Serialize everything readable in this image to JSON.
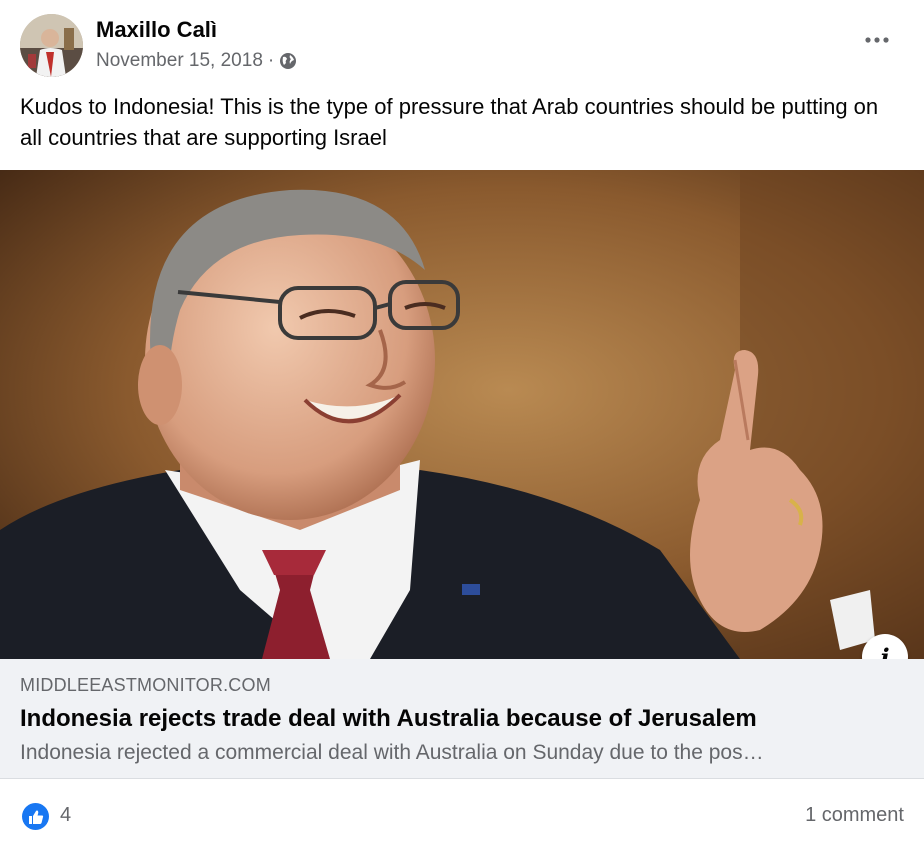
{
  "post": {
    "author": "Maxillo Calì",
    "date": "November 15, 2018",
    "separator": "·",
    "visibility_icon": "globe-icon",
    "menu_icon": "more-options-icon",
    "text": "Kudos to Indonesia! This is the type of pressure that Arab countries should be putting on all countries that are supporting Israel"
  },
  "link_preview": {
    "image_icon": "photo-of-smiling-man-pointing-finger",
    "info_icon": "info-icon",
    "domain": "MIDDLEEASTMONITOR.COM",
    "title": "Indonesia rejects trade deal with Australia because of Jerusalem",
    "description": "Indonesia rejected a commercial deal with Australia on Sunday due to the pos…"
  },
  "reactions": {
    "icon": "like-icon",
    "like_count": "4",
    "comments": "1 comment"
  },
  "colors": {
    "accent": "#1877f2",
    "secondary_text": "#65676b",
    "link_box_bg": "#f0f2f5"
  }
}
